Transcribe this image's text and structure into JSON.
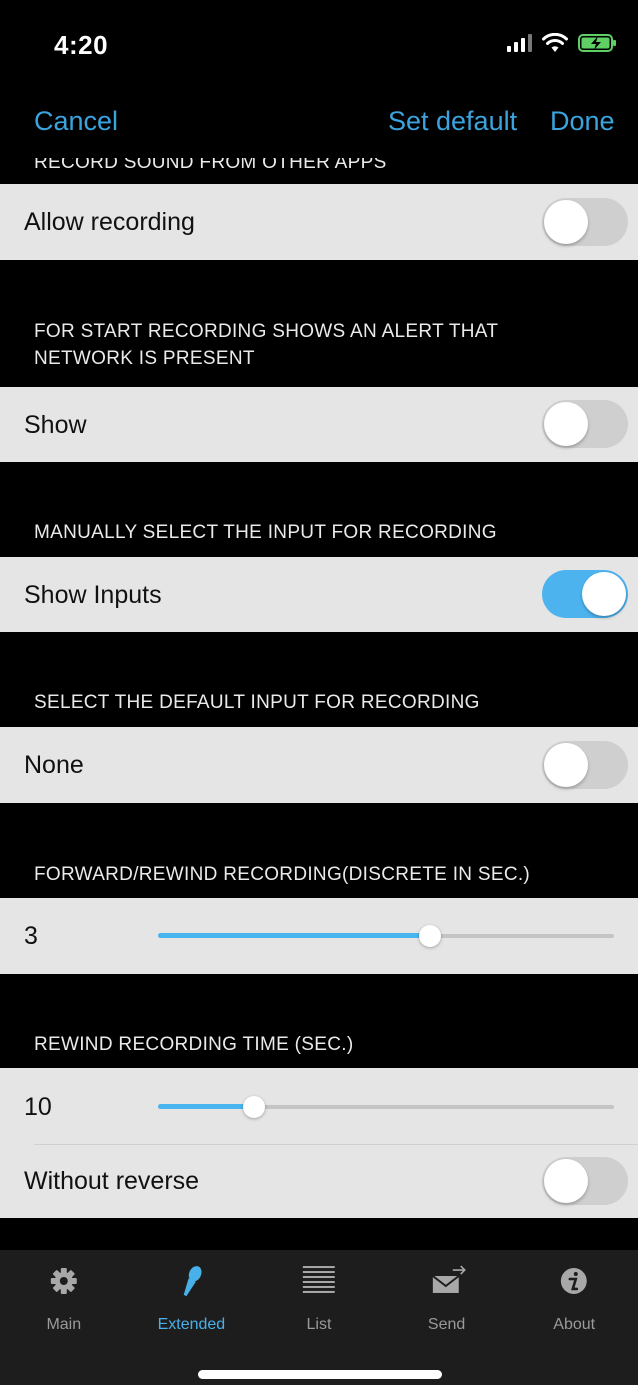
{
  "status_bar": {
    "time": "4:20"
  },
  "nav": {
    "cancel": "Cancel",
    "set_default": "Set default",
    "done": "Done"
  },
  "sections": {
    "record_other_apps": {
      "header": "RECORD SOUND FROM OTHER APPS",
      "cell_label": "Allow recording",
      "toggle_on": false
    },
    "network_alert": {
      "header": "FOR START RECORDING SHOWS AN ALERT THAT NETWORK IS PRESENT",
      "cell_label": "Show",
      "toggle_on": false
    },
    "manual_input": {
      "header": "MANUALLY SELECT THE INPUT FOR RECORDING",
      "cell_label": "Show Inputs",
      "toggle_on": true
    },
    "default_input": {
      "header": "SELECT THE DEFAULT INPUT FOR RECORDING",
      "cell_label": "None",
      "toggle_on": false
    },
    "forward_rewind": {
      "header": "FORWARD/REWIND RECORDING(DISCRETE IN SEC.)",
      "value_label": "3",
      "slider_fraction": 0.596
    },
    "rewind_time": {
      "header": "REWIND RECORDING TIME (SEC.)",
      "value_label": "10",
      "slider_fraction": 0.21,
      "reverse_label": "Without reverse",
      "reverse_toggle_on": false
    }
  },
  "tabs": [
    {
      "label": "Main",
      "icon": "gear-icon",
      "active": false
    },
    {
      "label": "Extended",
      "icon": "microphone-icon",
      "active": true
    },
    {
      "label": "List",
      "icon": "list-icon",
      "active": false
    },
    {
      "label": "Send",
      "icon": "send-envelope-icon",
      "active": false
    },
    {
      "label": "About",
      "icon": "info-icon",
      "active": false
    }
  ],
  "colors": {
    "accent": "#3ba3de",
    "toggle_on": "#4db3ee",
    "cell_background": "#e5e5e5",
    "background": "#000000",
    "tab_bar": "#1d1d1d"
  }
}
